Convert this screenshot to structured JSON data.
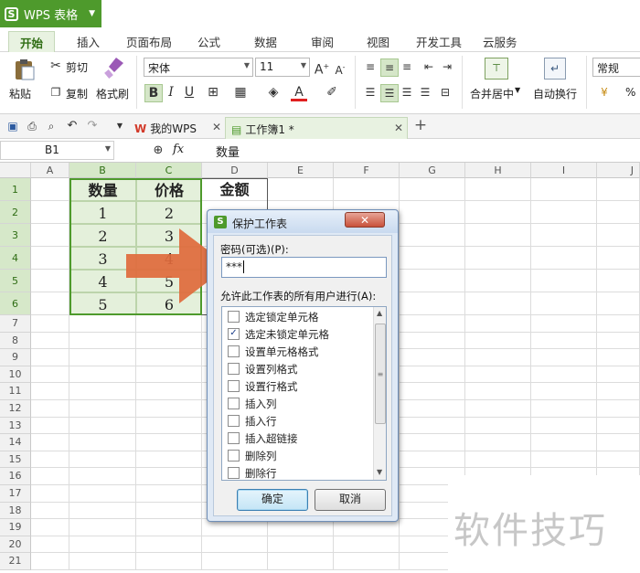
{
  "app": {
    "name": "WPS 表格"
  },
  "ribbon_tabs": [
    "开始",
    "插入",
    "页面布局",
    "公式",
    "数据",
    "审阅",
    "视图",
    "开发工具",
    "云服务"
  ],
  "active_tab": "开始",
  "ribbon": {
    "cut": "剪切",
    "paste": "粘贴",
    "copy": "复制",
    "format_painter": "格式刷",
    "font_name": "宋体",
    "font_size": "11",
    "merge_center": "合并居中",
    "wrap_text": "自动换行",
    "number_format": "常规",
    "percent": "%"
  },
  "doc_tabs": [
    {
      "label": "我的WPS"
    },
    {
      "label": "工作簿1 *"
    }
  ],
  "formula_bar": {
    "name_box": "B1",
    "fx": "fx",
    "content": "数量"
  },
  "columns": [
    "A",
    "B",
    "C",
    "D",
    "E",
    "F",
    "G",
    "H",
    "I",
    "J"
  ],
  "rows": [
    "1",
    "2",
    "3",
    "4",
    "5",
    "6",
    "7",
    "8",
    "9",
    "10",
    "11",
    "12",
    "13",
    "14",
    "15",
    "16",
    "17",
    "18",
    "19",
    "20",
    "21"
  ],
  "table": {
    "headers": [
      "数量",
      "价格",
      "金额"
    ],
    "quantity": [
      "1",
      "2",
      "3",
      "4",
      "5"
    ],
    "price": [
      "2",
      "3",
      "4",
      "5",
      "6"
    ]
  },
  "dialog": {
    "title": "保护工作表",
    "password_label": "密码(可选)(P):",
    "password_value": "***",
    "allow_label": "允许此工作表的所有用户进行(A):",
    "permissions": [
      {
        "label": "选定锁定单元格",
        "checked": false
      },
      {
        "label": "选定未锁定单元格",
        "checked": true
      },
      {
        "label": "设置单元格格式",
        "checked": false
      },
      {
        "label": "设置列格式",
        "checked": false
      },
      {
        "label": "设置行格式",
        "checked": false
      },
      {
        "label": "插入列",
        "checked": false
      },
      {
        "label": "插入行",
        "checked": false
      },
      {
        "label": "插入超链接",
        "checked": false
      },
      {
        "label": "删除列",
        "checked": false
      },
      {
        "label": "删除行",
        "checked": false
      }
    ],
    "ok": "确定",
    "cancel": "取消"
  },
  "watermark": "软件技巧",
  "colors": {
    "accent": "#4e9a2c",
    "arrow": "#e06a3c",
    "selection": "#e4f0db"
  }
}
